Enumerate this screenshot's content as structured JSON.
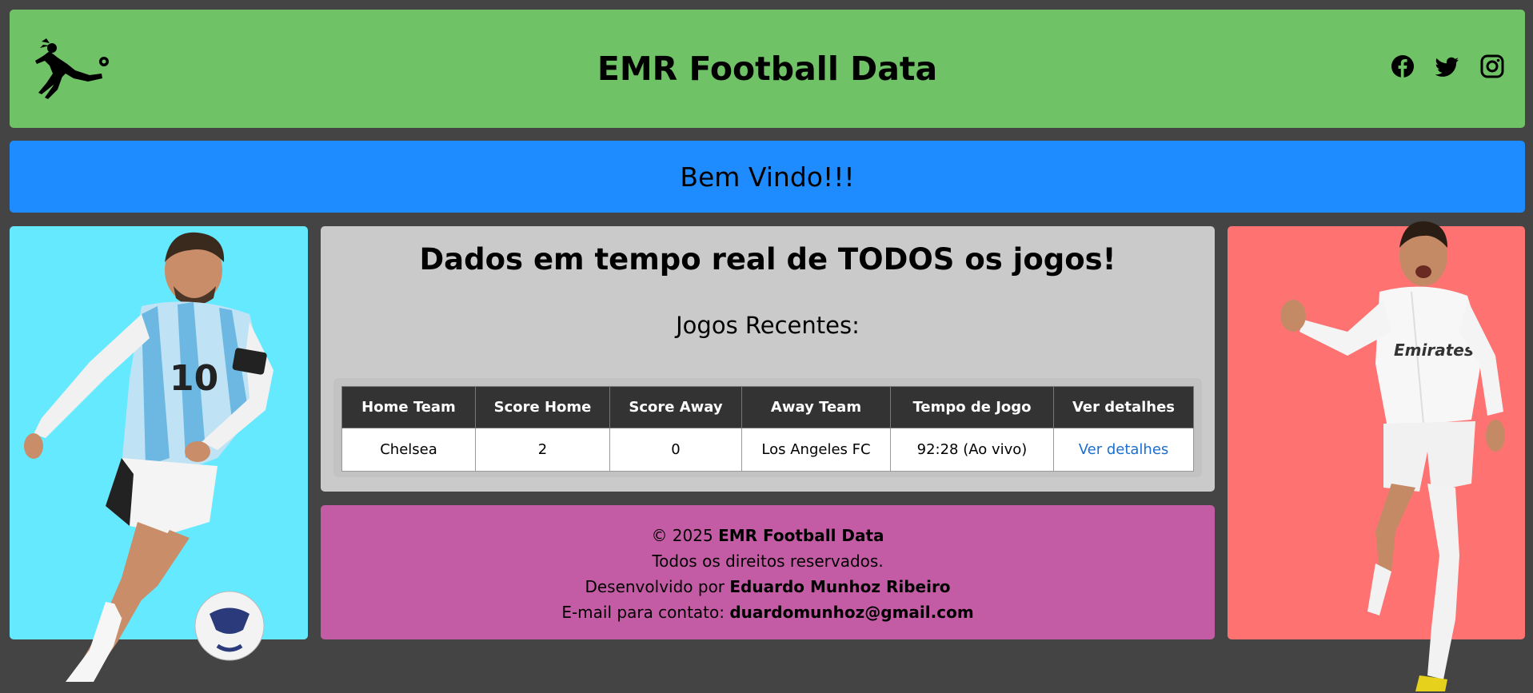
{
  "header": {
    "title": "EMR Football Data",
    "logo_icon": "football-player-logo-icon",
    "social": [
      {
        "name": "facebook-icon"
      },
      {
        "name": "twitter-icon"
      },
      {
        "name": "instagram-icon"
      }
    ],
    "color": "#70c267"
  },
  "banner": {
    "text": "Bem Vindo!!!",
    "color": "#1e8cff"
  },
  "left_panel": {
    "image": "messi-argentina-player-photo",
    "color": "#65e9ff"
  },
  "right_panel": {
    "image": "ronaldo-real-madrid-player-photo",
    "color": "#ff7272"
  },
  "main": {
    "heading": "Dados em tempo real de TODOS os jogos!",
    "subheading": "Jogos Recentes:",
    "columns": [
      "Home Team",
      "Score Home",
      "Score Away",
      "Away Team",
      "Tempo de Jogo",
      "Ver detalhes"
    ],
    "rows": [
      {
        "home_team": "Chelsea",
        "score_home": "2",
        "score_away": "0",
        "away_team": "Los Angeles FC",
        "tempo": "92:28 (Ao vivo)",
        "detalhes": "Ver detalhes"
      }
    ]
  },
  "footer": {
    "copyright_prefix": "© 2025",
    "brand": "EMR Football Data",
    "rights": "Todos os direitos reservados.",
    "dev_prefix": "Desenvolvido por",
    "dev_name": "Eduardo Munhoz Ribeiro",
    "email_prefix": "E-mail para contato:",
    "email": "duardomunhoz@gmail.com",
    "color": "#c45ca5"
  }
}
